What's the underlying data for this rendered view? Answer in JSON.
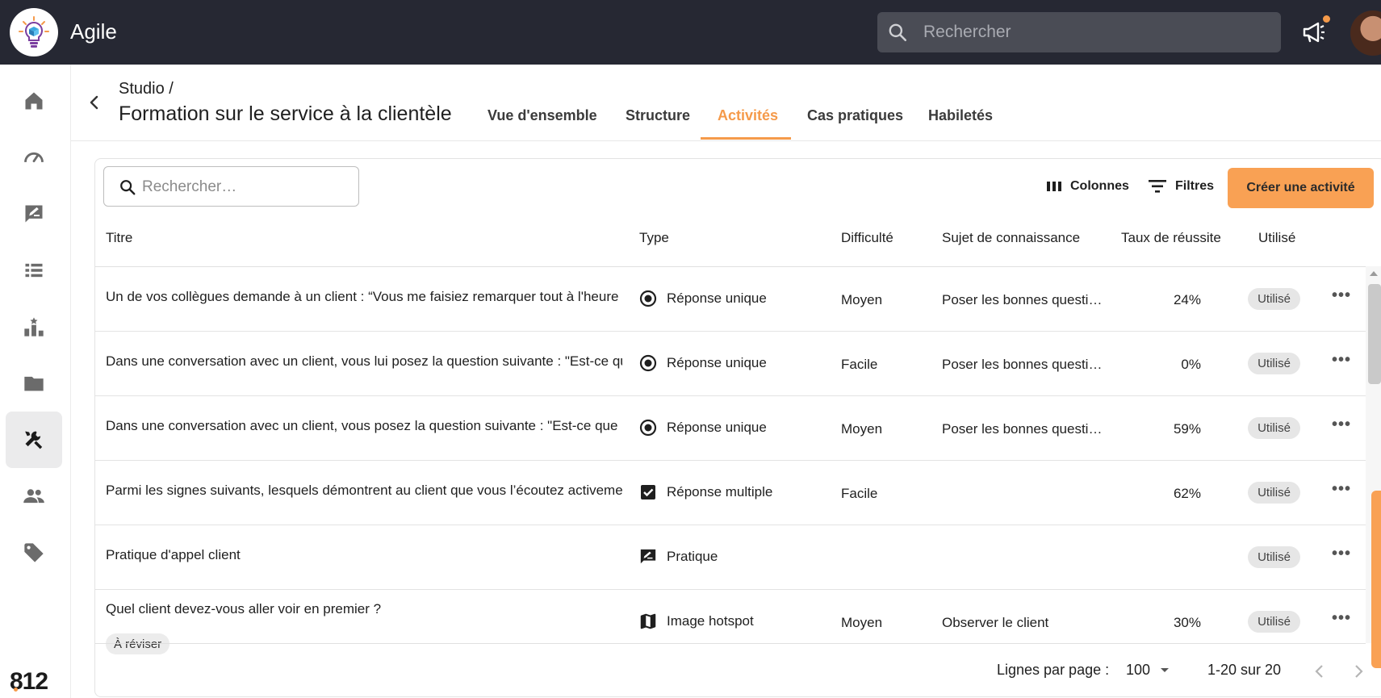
{
  "app": {
    "title": "Agile"
  },
  "topbar": {
    "search_placeholder": "Rechercher"
  },
  "breadcrumb": "Studio /",
  "page_title": "Formation sur le service à la clientèle",
  "tabs": [
    {
      "label": "Vue d'ensemble"
    },
    {
      "label": "Structure"
    },
    {
      "label": "Activités"
    },
    {
      "label": "Cas pratiques"
    },
    {
      "label": "Habiletés"
    }
  ],
  "toolbar": {
    "search_placeholder": "Rechercher…",
    "columns_label": "Colonnes",
    "filters_label": "Filtres",
    "create_label": "Créer une activité"
  },
  "columns": [
    "Titre",
    "Type",
    "Difficulté",
    "Sujet de connaissance",
    "Taux de réussite",
    "Utilisé"
  ],
  "rows": [
    {
      "title": "Un de vos collègues demande à un client : “Vous me faisiez remarquer tout à l'heure",
      "type": "Réponse unique",
      "type_icon": "radio-icon",
      "difficulty": "Moyen",
      "subject": "Poser les bonnes questions",
      "rate": "24%",
      "used": "Utilisé"
    },
    {
      "title": "Dans une conversation avec un client, vous lui posez la question suivante : \"Est-ce que",
      "type": "Réponse unique",
      "type_icon": "radio-icon",
      "difficulty": "Facile",
      "subject": "Poser les bonnes questions",
      "rate": "0%",
      "used": "Utilisé"
    },
    {
      "title": "Dans une conversation avec un client, vous posez la question suivante : \"Est-ce que",
      "type": "Réponse unique",
      "type_icon": "radio-icon",
      "difficulty": "Moyen",
      "subject": "Poser les bonnes questions",
      "rate": "59%",
      "used": "Utilisé"
    },
    {
      "title": "Parmi les signes suivants, lesquels démontrent au client que vous l’écoutez activement",
      "type": "Réponse multiple",
      "type_icon": "checkbox-icon",
      "difficulty": "Facile",
      "subject": "",
      "rate": "62%",
      "used": "Utilisé"
    },
    {
      "title": "Pratique d'appel client",
      "type": "Pratique",
      "type_icon": "practice-icon",
      "difficulty": "",
      "subject": "",
      "rate": "",
      "used": "Utilisé"
    },
    {
      "title": "Quel client devez-vous aller voir en premier ?",
      "badge": "À réviser",
      "type": "Image hotspot",
      "type_icon": "map-icon",
      "difficulty": "Moyen",
      "subject": "Observer le client",
      "rate": "30%",
      "used": "Utilisé"
    }
  ],
  "footer": {
    "rows_per_page_label": "Lignes par page :",
    "rows_per_page_value": "100",
    "range": "1-20 sur 20"
  },
  "brand": "812",
  "colors": {
    "accent": "#f9a154",
    "topbar": "#262833"
  }
}
